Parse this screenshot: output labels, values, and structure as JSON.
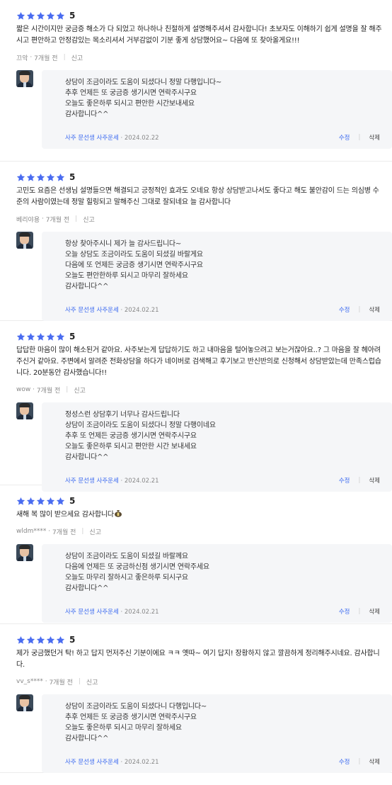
{
  "colors": {
    "star": "#4a6cf0",
    "accent": "#3d6bf0",
    "reply_bg": "#f5f6f8"
  },
  "reviews": [
    {
      "stars": 5,
      "score": "5",
      "text": "짧은 시간이지만 궁금증 해소가 다 되었고 하나하나 친절하게 설명해주셔서 감사합니다! 초보자도 이해하기 쉽게 설명을 잘 해주시고 편안하고 안정감있는 목소리셔서 거부감없이 기분 좋게 상담했어요~ 다음에 또 찾아올게요!!!",
      "user": "끄악",
      "time": "7개월 전",
      "report": "신고",
      "reply": {
        "text": "상담이 조금이라도 도움이 되셨다니 정말 다행입니다~\n추후 언제든 또 궁금증 생기시면 연락주시구요\n오늘도 좋은하루 되시고 편안한 시간보내세요\n감사합니다^^",
        "author": "사주 문선생 사주운세",
        "date": "· 2024.02.22",
        "edit": "수정",
        "delete": "삭제"
      }
    },
    {
      "stars": 5,
      "score": "5",
      "text": "고민도 요즘은 선생님 설명들으면 해결되고 긍정적인 효과도 오네요 항상 상담받고나서도 좋다고 해도 불안감이 드는 의심병 수준의 사람이였는데 정말 힐링되고 말해주신 그대로 잘되네요 늘 감사합니다",
      "user": "베리야용",
      "time": "7개월 전",
      "report": "신고",
      "reply": {
        "text": "항상 찾아주시니 제가 늘 감사드립니다~\n오늘 상담도 조금이라도 도움이 되셨길 바랄게요\n다음에 또 언제든 궁금증 생기시면 연락주시구요\n오늘도 편안한하루 되시고 마무리 잘하세요\n감사합니다^^",
        "author": "사주 문선생 사주운세",
        "date": "· 2024.02.21",
        "edit": "수정",
        "delete": "삭제"
      }
    },
    {
      "stars": 5,
      "score": "5",
      "text": "답답한 마음이 많이 해소된거 같아요. 사주보는게 답답하기도 하고 내마음을 털어놓으려고 보는거잖아요..? 그 마음을 잘 헤아려주신거 같아요. 주변에서 알려준 전화상담을 하다가 네이버로 검색해고 후기보고 반신반의로 신청해서 상담받았는데 만족스럽습니다. 20분동안 감사했습니다!!",
      "user": "wow",
      "time": "7개월 전",
      "report": "신고",
      "reply": {
        "text": "정성스런 상담후기 너무나 감사드립니다\n상담이 조금이라도 도움이 되셨다니 정말 다행이네요\n추후 또 언제든 궁금증 생기시면 연락주시구요\n오늘도 좋은하루 되시고 편안한 시간 보내세요\n감사합니다^^",
        "author": "사주 문선생 사주운세",
        "date": "· 2024.02.21",
        "edit": "수정",
        "delete": "삭제"
      }
    },
    {
      "stars": 5,
      "score": "5",
      "text": "새해 복 많이 받으세요 감사합니다",
      "user": "wldm****",
      "time": "7개월 전",
      "report": "신고",
      "reply": {
        "text": "상담이 조금이라도 도움이 되셨길 바랄께요\n다음에 언제든 또 궁금하신점 생기시면 연락주세요\n오늘도 마무리 잘하시고 좋은하루 되시구요\n감사합니다^^",
        "author": "사주 문선생 사주운세",
        "date": "· 2024.02.21",
        "edit": "수정",
        "delete": "삭제"
      }
    },
    {
      "stars": 5,
      "score": "5",
      "text": "제가 궁금했던거 탁! 하고 답지 먼저주신 기분이에요 ㅋㅋ 옛따~ 여기 답지! 장황하지 않고 깔끔하게 정리해주시네요. 감사합니다.",
      "user": "vv_s****",
      "time": "7개월 전",
      "report": "신고",
      "reply": {
        "text": "상담이 조금이라도 도움이 되셨다니 다행입니다~\n추후 언제든 또 궁금증 생기시면 연락주시구요\n오늘도 좋은하루 되시고 마무리 잘하세요\n감사합니다^^",
        "author": "사주 문선생 사주운세",
        "date": "· 2024.02.21",
        "edit": "수정",
        "delete": "삭제"
      }
    }
  ]
}
